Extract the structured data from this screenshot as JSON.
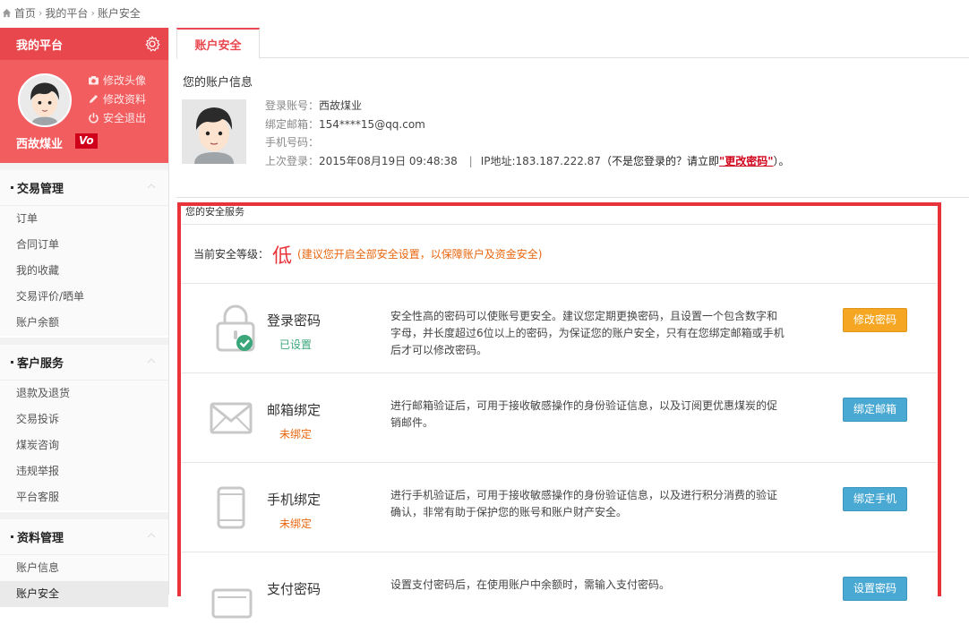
{
  "breadcrumb": {
    "home": "首页",
    "platform": "我的平台",
    "current": "账户安全"
  },
  "sidebar": {
    "title": "我的平台",
    "username": "西故煤业",
    "badge": "Vo",
    "profile_links": [
      "修改头像",
      "修改资料",
      "安全退出"
    ],
    "groups": [
      {
        "title": "交易管理",
        "items": [
          "订单",
          "合同订单",
          "我的收藏",
          "交易评价/晒单",
          "账户余额"
        ]
      },
      {
        "title": "客户服务",
        "items": [
          "退款及退货",
          "交易投诉",
          "煤炭咨询",
          "违规举报",
          "平台客服"
        ]
      },
      {
        "title": "资料管理",
        "items": [
          "账户信息",
          "账户安全"
        ]
      }
    ]
  },
  "tab": {
    "label": "账户安全"
  },
  "account": {
    "title": "您的账户信息",
    "login_label": "登录账号：",
    "login_value": "西故煤业",
    "email_label": "绑定邮箱：",
    "email_value": "154****15@qq.com",
    "phone_label": "手机号码：",
    "phone_value": "",
    "last_label": "上次登录：",
    "last_value": "2015年08月19日 09:48:38",
    "ip_sep": "|",
    "ip_label": "IP地址:",
    "ip_value": "183.187.222.87",
    "not_me": "（不是您登录的？请立即",
    "change_pwd_link": "\"更改密码\"",
    "not_me_end": "）。"
  },
  "security": {
    "section_title": "您的安全服务",
    "level_label": "当前安全等级：",
    "level_value": "低",
    "level_tip": "(建议您开启全部安全设置，以保障账户及资金安全)",
    "services": [
      {
        "name": "登录密码",
        "status": "已设置",
        "desc": "安全性高的密码可以使账号更安全。建议您定期更换密码，且设置一个包含数字和字母，并长度超过6位以上的密码，为保证您的账户安全，只有在您绑定邮箱或手机后才可以修改密码。",
        "button": "修改密码"
      },
      {
        "name": "邮箱绑定",
        "status": "未绑定",
        "desc": "进行邮箱验证后，可用于接收敏感操作的身份验证信息，以及订阅更优惠煤炭的促销邮件。",
        "button": "绑定邮箱"
      },
      {
        "name": "手机绑定",
        "status": "未绑定",
        "desc": "进行手机验证后，可用于接收敏感操作的身份验证信息，以及进行积分消费的验证确认，非常有助于保护您的账号和账户财产安全。",
        "button": "绑定手机"
      },
      {
        "name": "支付密码",
        "status": "",
        "desc": "设置支付密码后，在使用账户中余额时，需输入支付密码。",
        "button": "设置密码"
      }
    ]
  }
}
